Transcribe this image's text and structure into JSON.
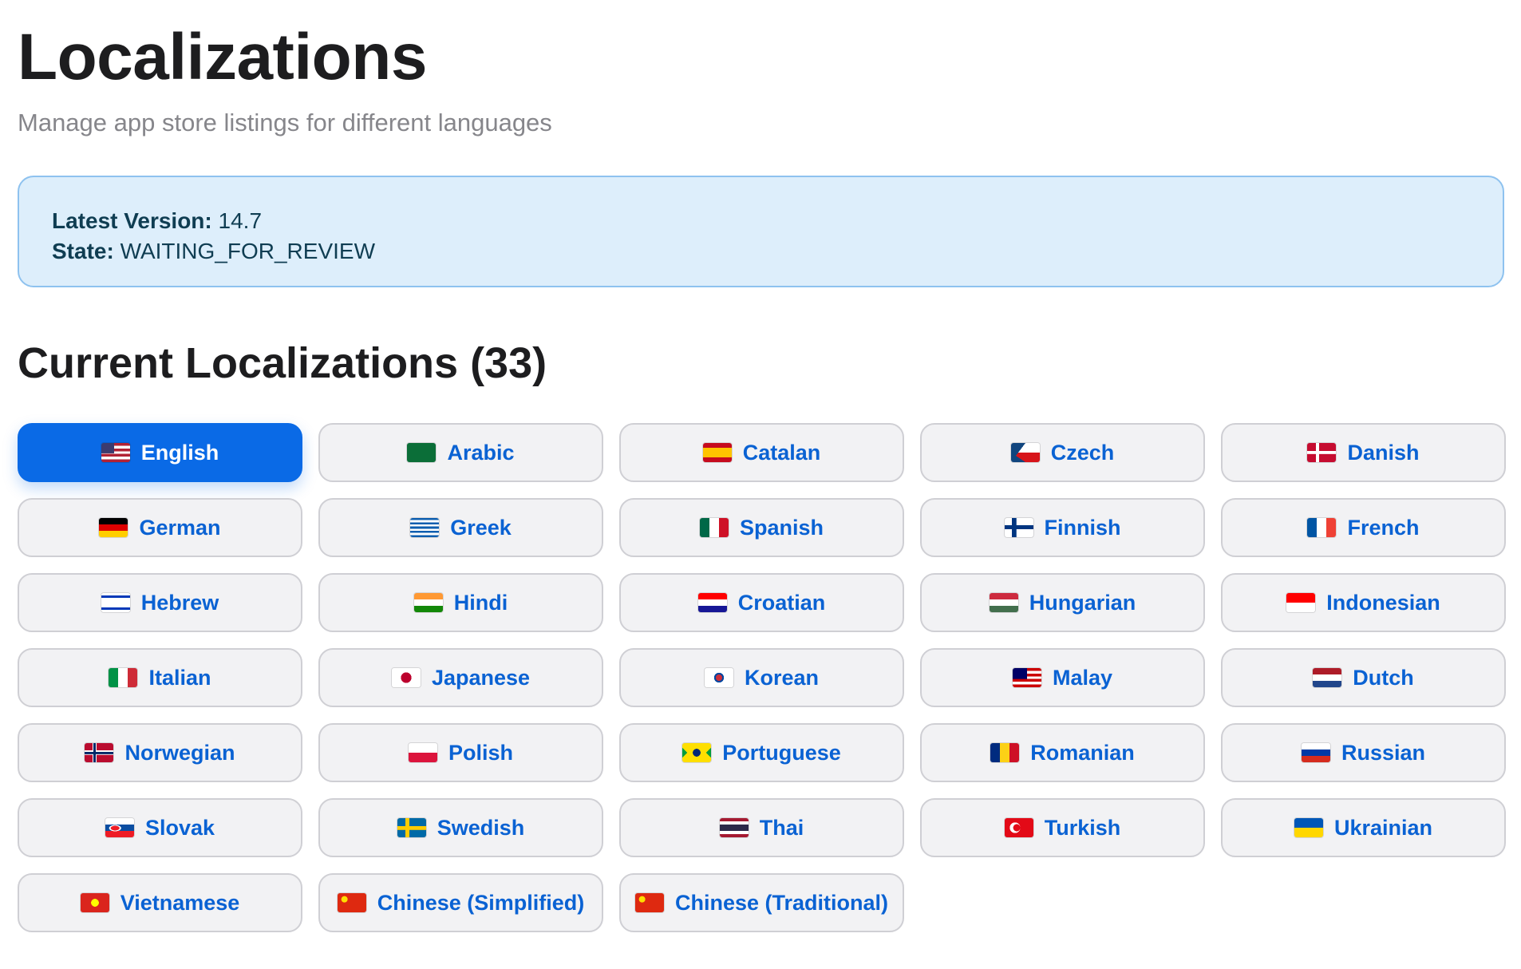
{
  "header": {
    "title": "Localizations",
    "subtitle": "Manage app store listings for different languages"
  },
  "info": {
    "version_label": "Latest Version:",
    "version_value": "14.7",
    "state_label": "State:",
    "state_value": "WAITING_FOR_REVIEW"
  },
  "section": {
    "title": "Current Localizations (33)"
  },
  "localizations": [
    {
      "label": "English",
      "flag": "us-flag-icon",
      "active": true
    },
    {
      "label": "Arabic",
      "flag": "sa-flag-icon"
    },
    {
      "label": "Catalan",
      "flag": "es-flag-icon"
    },
    {
      "label": "Czech",
      "flag": "cz-flag-icon"
    },
    {
      "label": "Danish",
      "flag": "dk-flag-icon"
    },
    {
      "label": "German",
      "flag": "de-flag-icon"
    },
    {
      "label": "Greek",
      "flag": "gr-flag-icon"
    },
    {
      "label": "Spanish",
      "flag": "mx-flag-icon"
    },
    {
      "label": "Finnish",
      "flag": "fi-flag-icon"
    },
    {
      "label": "French",
      "flag": "fr-flag-icon"
    },
    {
      "label": "Hebrew",
      "flag": "il-flag-icon"
    },
    {
      "label": "Hindi",
      "flag": "in-flag-icon"
    },
    {
      "label": "Croatian",
      "flag": "hr-flag-icon"
    },
    {
      "label": "Hungarian",
      "flag": "hu-flag-icon"
    },
    {
      "label": "Indonesian",
      "flag": "id-flag-icon"
    },
    {
      "label": "Italian",
      "flag": "it-flag-icon"
    },
    {
      "label": "Japanese",
      "flag": "jp-flag-icon"
    },
    {
      "label": "Korean",
      "flag": "kr-flag-icon"
    },
    {
      "label": "Malay",
      "flag": "my-flag-icon"
    },
    {
      "label": "Dutch",
      "flag": "nl-flag-icon"
    },
    {
      "label": "Norwegian",
      "flag": "no-flag-icon"
    },
    {
      "label": "Polish",
      "flag": "pl-flag-icon"
    },
    {
      "label": "Portuguese",
      "flag": "br-flag-icon"
    },
    {
      "label": "Romanian",
      "flag": "ro-flag-icon"
    },
    {
      "label": "Russian",
      "flag": "ru-flag-icon"
    },
    {
      "label": "Slovak",
      "flag": "sk-flag-icon"
    },
    {
      "label": "Swedish",
      "flag": "se-flag-icon"
    },
    {
      "label": "Thai",
      "flag": "th-flag-icon"
    },
    {
      "label": "Turkish",
      "flag": "tr-flag-icon"
    },
    {
      "label": "Ukrainian",
      "flag": "ua-flag-icon"
    },
    {
      "label": "Vietnamese",
      "flag": "vn-flag-icon"
    },
    {
      "label": "Chinese (Simplified)",
      "flag": "cn-flag-icon"
    },
    {
      "label": "Chinese (Traditional)",
      "flag": "cn-flag-icon"
    }
  ],
  "colors": {
    "accent": "#0a6ae6",
    "link": "#0a62d3",
    "info_bg": "#ddeefb",
    "info_border": "#8ec2ef"
  }
}
